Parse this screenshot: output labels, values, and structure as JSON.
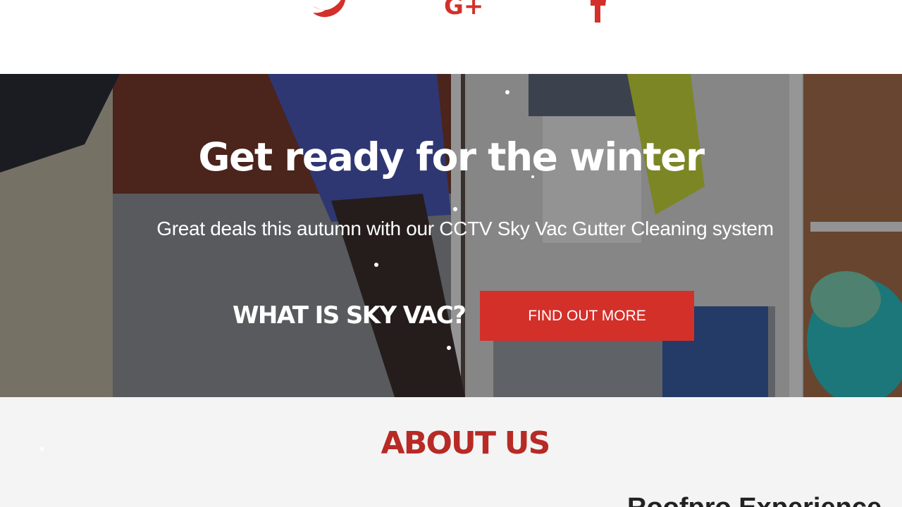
{
  "social": {
    "icons": [
      {
        "name": "twitter-icon",
        "color": "#d3302a"
      },
      {
        "name": "google-plus-icon",
        "color": "#d3302a"
      },
      {
        "name": "facebook-icon",
        "color": "#d3302a"
      }
    ]
  },
  "hero": {
    "title": "Get ready for the winter",
    "subtitle": "Great deals this autumn with our CCTV Sky Vac Gutter Cleaning system",
    "question": "WHAT IS SKY VAC?",
    "button_label": "FIND OUT MORE",
    "button_color": "#d3302a"
  },
  "about": {
    "title": "ABOUT US",
    "title_color": "#b72a25",
    "subheading": "Roofpro Experience"
  }
}
